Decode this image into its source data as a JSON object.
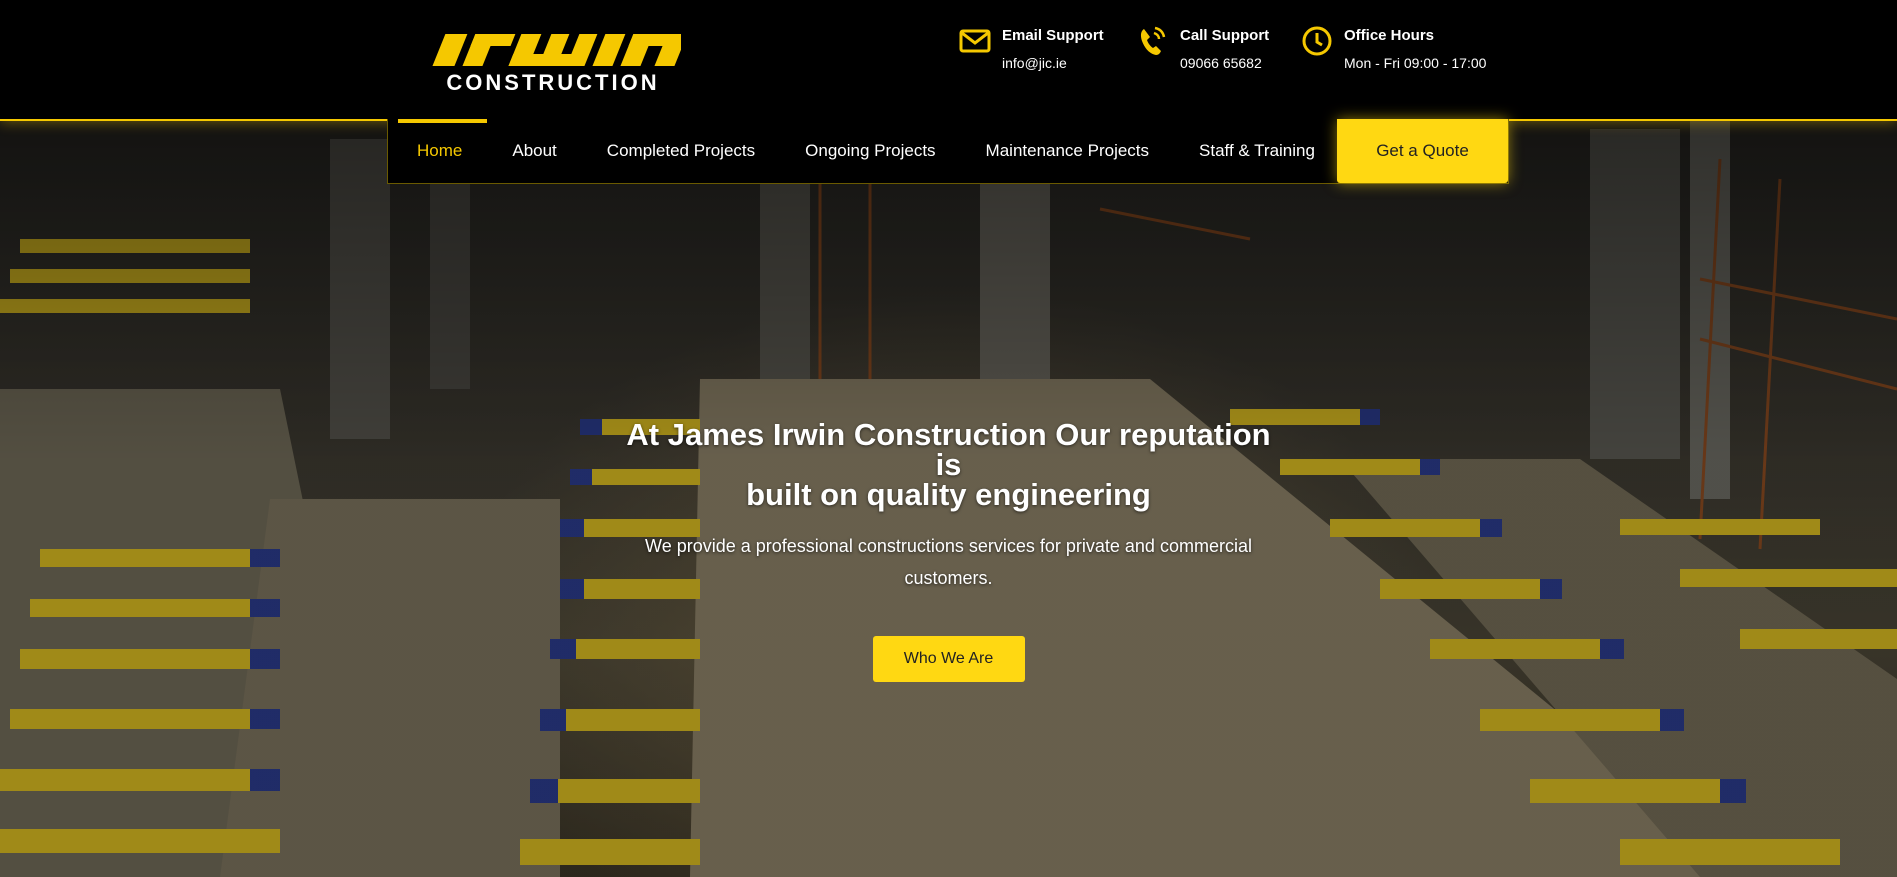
{
  "brand": {
    "logo_word": "irwin",
    "logo_sub": "CONSTRUCTION",
    "accent": "#f5c800",
    "button_yellow": "#ffd812"
  },
  "contacts": [
    {
      "icon": "envelope-icon",
      "label": "Email Support",
      "value": "info@jic.ie"
    },
    {
      "icon": "phone-icon",
      "label": "Call Support",
      "value": "09066 65682"
    },
    {
      "icon": "clock-icon",
      "label": "Office Hours",
      "value": "Mon - Fri 09:00 - 17:00"
    }
  ],
  "nav": {
    "items": [
      {
        "label": "Home",
        "active": true
      },
      {
        "label": "About"
      },
      {
        "label": "Completed Projects"
      },
      {
        "label": "Ongoing Projects"
      },
      {
        "label": "Maintenance Projects"
      },
      {
        "label": "Staff & Training"
      }
    ],
    "quote_label": "Get a Quote"
  },
  "hero": {
    "headline_line1": "At James Irwin Construction Our reputation",
    "headline_line2": "is",
    "headline_line3": "built on quality engineering",
    "subtitle": "We provide a professional constructions services for private and commercial customers.",
    "cta_label": "Who We Are"
  }
}
